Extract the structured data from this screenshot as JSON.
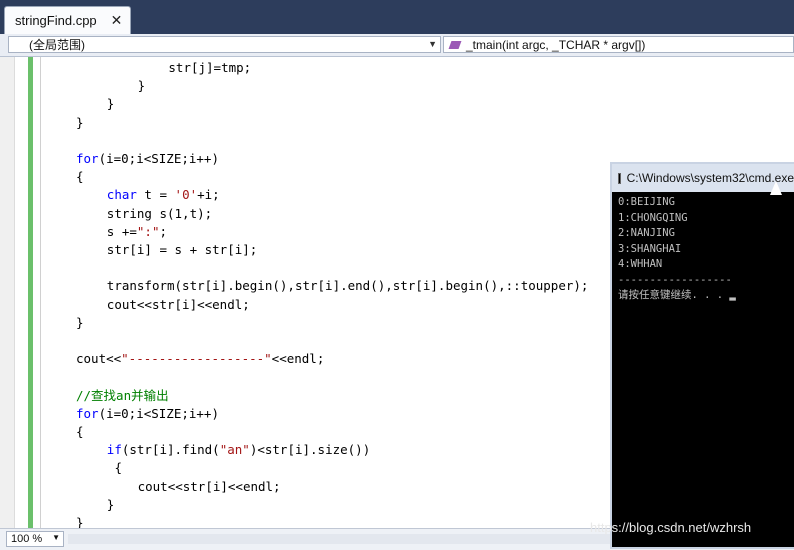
{
  "tab": {
    "filename": "stringFind.cpp",
    "close": "✕"
  },
  "nav": {
    "scope": "(全局范围)",
    "function": "_tmain(int argc, _TCHAR * argv[])"
  },
  "code_lines": [
    {
      "indent": "            ",
      "parts": [
        [
          "",
          "str[j]=tmp;"
        ]
      ]
    },
    {
      "indent": "        ",
      "parts": [
        [
          "",
          "}"
        ]
      ]
    },
    {
      "indent": "    ",
      "parts": [
        [
          "",
          "}"
        ]
      ]
    },
    {
      "indent": "",
      "parts": [
        [
          "",
          "}"
        ]
      ]
    },
    {
      "indent": "",
      "parts": [
        [
          "",
          ""
        ]
      ]
    },
    {
      "indent": "",
      "parts": [
        [
          "kw",
          "for"
        ],
        [
          "",
          "(i=0;i<SIZE;i++)"
        ]
      ]
    },
    {
      "indent": "",
      "parts": [
        [
          "",
          "{"
        ]
      ]
    },
    {
      "indent": "    ",
      "parts": [
        [
          "kw",
          "char"
        ],
        [
          "",
          " t = "
        ],
        [
          "str",
          "'0'"
        ],
        [
          "",
          "+i;"
        ]
      ]
    },
    {
      "indent": "    ",
      "parts": [
        [
          "",
          "string s(1,t);"
        ]
      ]
    },
    {
      "indent": "    ",
      "parts": [
        [
          "",
          "s +="
        ],
        [
          "str",
          "\":\""
        ],
        [
          "",
          ";"
        ]
      ]
    },
    {
      "indent": "    ",
      "parts": [
        [
          "",
          "str[i] = s + str[i];"
        ]
      ]
    },
    {
      "indent": "",
      "parts": [
        [
          "",
          ""
        ]
      ]
    },
    {
      "indent": "    ",
      "parts": [
        [
          "",
          "transform(str[i].begin(),str[i].end(),str[i].begin(),::toupper);"
        ]
      ]
    },
    {
      "indent": "    ",
      "parts": [
        [
          "",
          "cout<<str[i]<<endl;"
        ]
      ]
    },
    {
      "indent": "",
      "parts": [
        [
          "",
          "}"
        ]
      ]
    },
    {
      "indent": "",
      "parts": [
        [
          "",
          ""
        ]
      ]
    },
    {
      "indent": "",
      "parts": [
        [
          "",
          "cout<<"
        ],
        [
          "str",
          "\"------------------\""
        ],
        [
          "",
          "<<endl;"
        ]
      ]
    },
    {
      "indent": "",
      "parts": [
        [
          "",
          ""
        ]
      ]
    },
    {
      "indent": "",
      "parts": [
        [
          "cm",
          "//查找an并输出"
        ]
      ]
    },
    {
      "indent": "",
      "parts": [
        [
          "kw",
          "for"
        ],
        [
          "",
          "(i=0;i<SIZE;i++)"
        ]
      ]
    },
    {
      "indent": "",
      "parts": [
        [
          "",
          "{"
        ]
      ]
    },
    {
      "indent": "    ",
      "parts": [
        [
          "kw",
          "if"
        ],
        [
          "",
          "(str[i].find("
        ],
        [
          "str",
          "\"an\""
        ],
        [
          "",
          ")<str[i].size())"
        ]
      ]
    },
    {
      "indent": "     ",
      "parts": [
        [
          "",
          "{"
        ]
      ]
    },
    {
      "indent": "        ",
      "parts": [
        [
          "",
          "cout<<str[i]<<endl;"
        ]
      ]
    },
    {
      "indent": "    ",
      "parts": [
        [
          "",
          "}"
        ]
      ]
    },
    {
      "indent": "",
      "parts": [
        [
          "",
          "}"
        ]
      ]
    }
  ],
  "console": {
    "title": "C:\\Windows\\system32\\cmd.exe",
    "lines": [
      "0:BEIJING",
      "1:CHONGQING",
      "2:NANJING",
      "3:SHANGHAI",
      "4:WHHAN",
      "------------------",
      "请按任意键继续. . . ▂"
    ]
  },
  "status": {
    "zoom": "100 %"
  },
  "watermark": "https://blog.csdn.net/wzhrsh"
}
